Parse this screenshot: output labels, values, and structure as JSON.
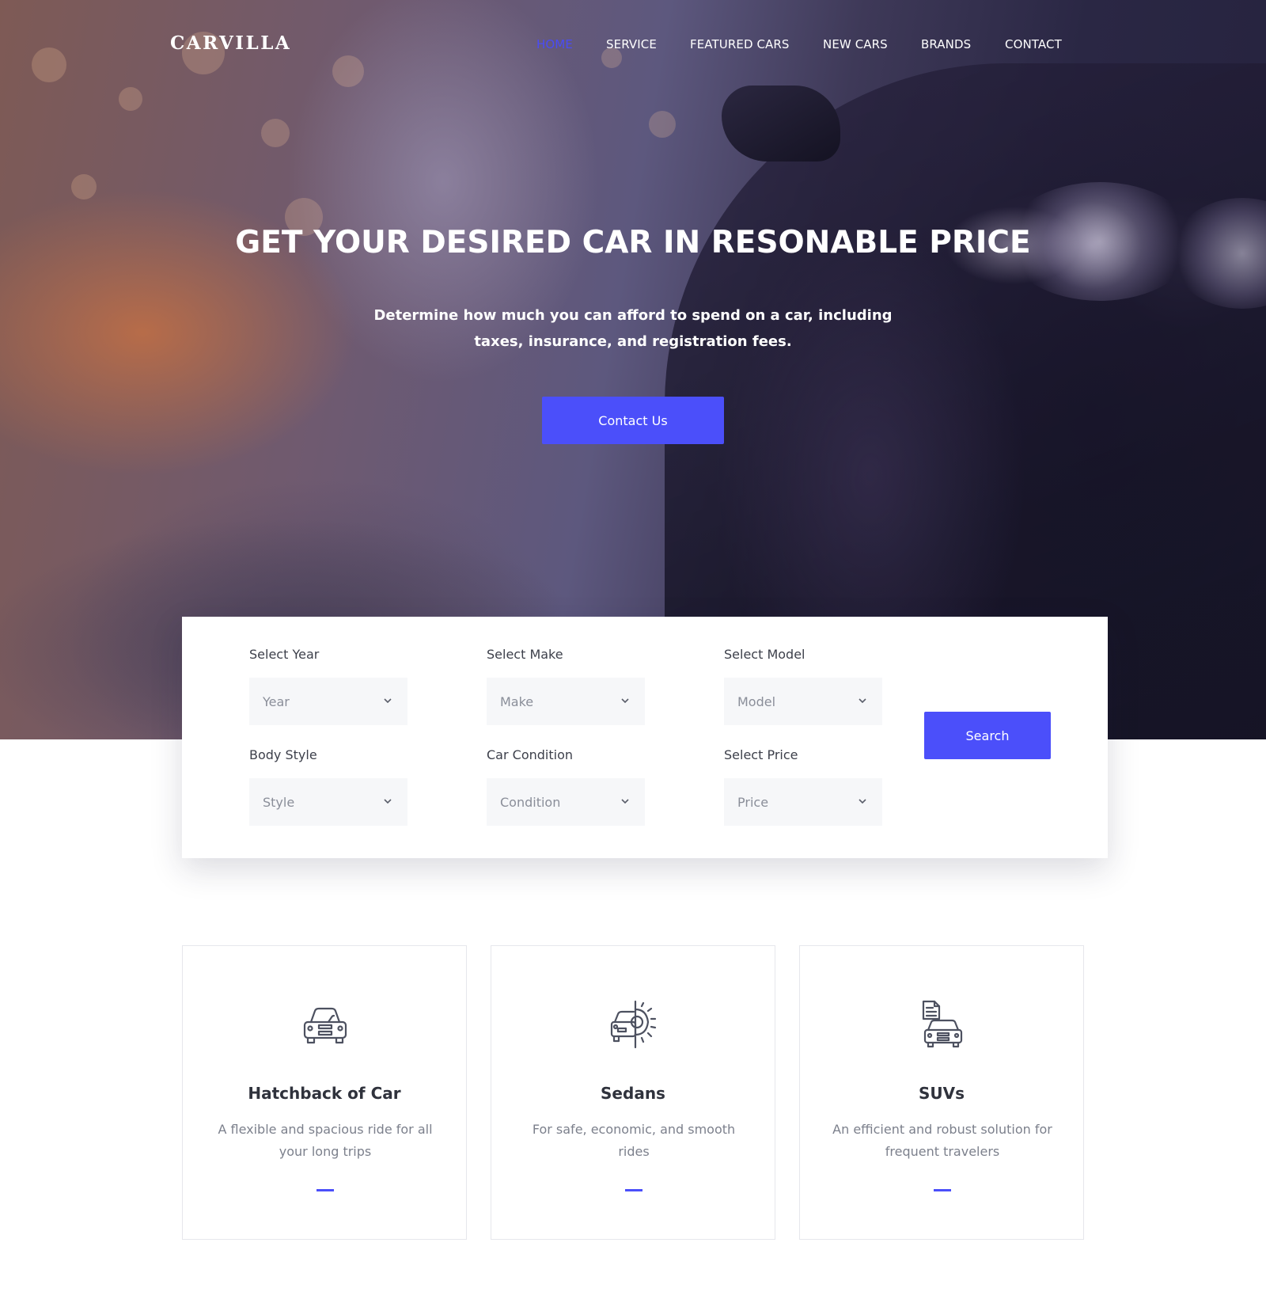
{
  "brand": {
    "logo_text": "CARVILLA",
    "accent_color": "#4b4ffa"
  },
  "nav": {
    "items": [
      {
        "label": "HOME",
        "active": true
      },
      {
        "label": "SERVICE",
        "active": false
      },
      {
        "label": "FEATURED CARS",
        "active": false
      },
      {
        "label": "NEW CARS",
        "active": false
      },
      {
        "label": "BRANDS",
        "active": false
      },
      {
        "label": "CONTACT",
        "active": false
      }
    ]
  },
  "hero": {
    "title": "GET YOUR DESIRED CAR IN RESONABLE PRICE",
    "subtitle": "Determine how much you can afford to spend on a car, including taxes, insurance, and registration fees.",
    "cta_label": "Contact Us"
  },
  "search": {
    "fields": [
      {
        "label": "Select Year",
        "value": "Year"
      },
      {
        "label": "Select Make",
        "value": "Make"
      },
      {
        "label": "Select Model",
        "value": "Model"
      },
      {
        "label": "Body Style",
        "value": "Style"
      },
      {
        "label": "Car Condition",
        "value": "Condition"
      },
      {
        "label": "Select Price",
        "value": "Price"
      }
    ],
    "button_label": "Search"
  },
  "services": [
    {
      "icon": "car-front-icon",
      "title": "Hatchback of Car",
      "description": "A flexible and spacious ride for all your long trips"
    },
    {
      "icon": "car-gear-icon",
      "title": "Sedans",
      "description": "For safe, economic, and smooth rides"
    },
    {
      "icon": "car-document-icon",
      "title": "SUVs",
      "description": "An efficient and robust solution for frequent travelers"
    }
  ]
}
